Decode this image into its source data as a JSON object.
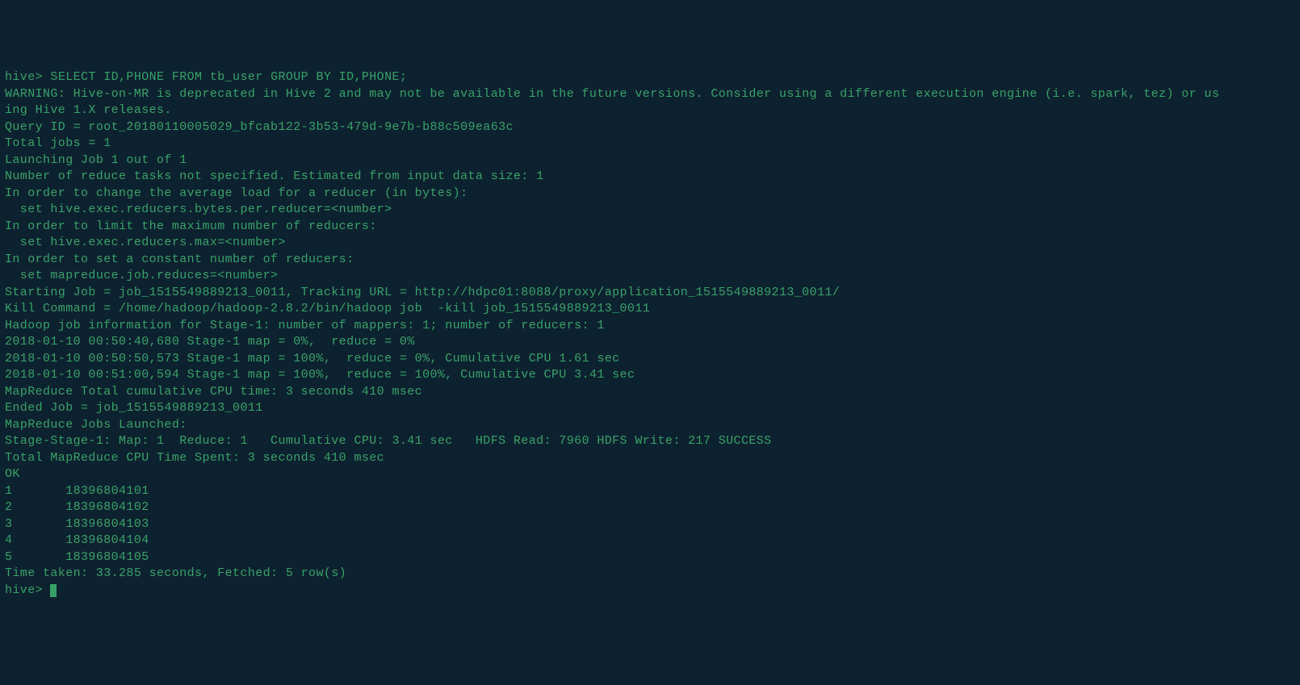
{
  "prompt1": "hive> ",
  "sql": "SELECT ID,PHONE FROM tb_user GROUP BY ID,PHONE;",
  "lines": [
    "WARNING: Hive-on-MR is deprecated in Hive 2 and may not be available in the future versions. Consider using a different execution engine (i.e. spark, tez) or us",
    "ing Hive 1.X releases.",
    "Query ID = root_20180110005029_bfcab122-3b53-479d-9e7b-b88c509ea63c",
    "Total jobs = 1",
    "Launching Job 1 out of 1",
    "Number of reduce tasks not specified. Estimated from input data size: 1",
    "In order to change the average load for a reducer (in bytes):",
    "  set hive.exec.reducers.bytes.per.reducer=<number>",
    "In order to limit the maximum number of reducers:",
    "  set hive.exec.reducers.max=<number>",
    "In order to set a constant number of reducers:",
    "  set mapreduce.job.reduces=<number>",
    "Starting Job = job_1515549889213_0011, Tracking URL = http://hdpc01:8088/proxy/application_1515549889213_0011/",
    "Kill Command = /home/hadoop/hadoop-2.8.2/bin/hadoop job  -kill job_1515549889213_0011",
    "Hadoop job information for Stage-1: number of mappers: 1; number of reducers: 1",
    "2018-01-10 00:50:40,680 Stage-1 map = 0%,  reduce = 0%",
    "2018-01-10 00:50:50,573 Stage-1 map = 100%,  reduce = 0%, Cumulative CPU 1.61 sec",
    "2018-01-10 00:51:00,594 Stage-1 map = 100%,  reduce = 100%, Cumulative CPU 3.41 sec",
    "MapReduce Total cumulative CPU time: 3 seconds 410 msec",
    "Ended Job = job_1515549889213_0011",
    "MapReduce Jobs Launched:",
    "Stage-Stage-1: Map: 1  Reduce: 1   Cumulative CPU: 3.41 sec   HDFS Read: 7960 HDFS Write: 217 SUCCESS",
    "Total MapReduce CPU Time Spent: 3 seconds 410 msec",
    "OK"
  ],
  "rows": [
    {
      "id": "1",
      "phone": "18396804101"
    },
    {
      "id": "2",
      "phone": "18396804102"
    },
    {
      "id": "3",
      "phone": "18396804103"
    },
    {
      "id": "4",
      "phone": "18396804104"
    },
    {
      "id": "5",
      "phone": "18396804105"
    }
  ],
  "footer": "Time taken: 33.285 seconds, Fetched: 5 row(s)",
  "prompt2": "hive> "
}
